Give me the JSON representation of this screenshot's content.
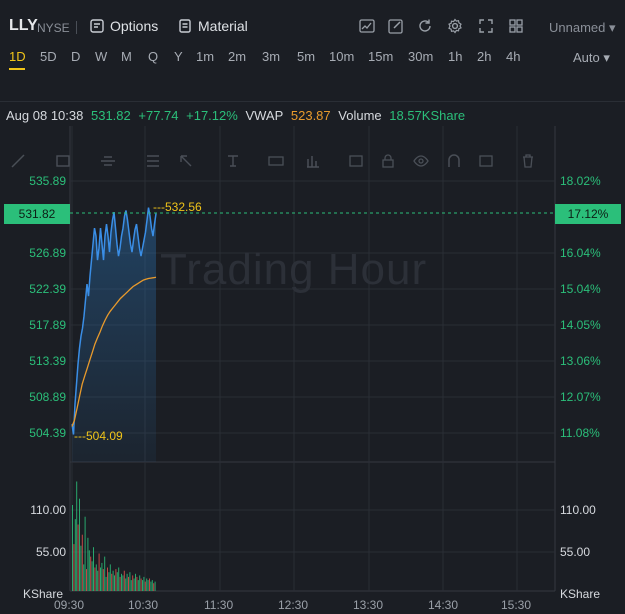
{
  "header": {
    "symbol": "LLY",
    "exchange": "NYSE",
    "options_label": "Options",
    "material_label": "Material",
    "layout_name": "Unnamed"
  },
  "periods": [
    "1D",
    "5D",
    "D",
    "W",
    "M",
    "Q",
    "Y",
    "1m",
    "2m",
    "3m",
    "5m",
    "10m",
    "15m",
    "30m",
    "1h",
    "2h",
    "4h"
  ],
  "active_period": "1D",
  "scale_mode": "Auto",
  "info": {
    "datetime": "Aug 08 10:38",
    "price": "531.82",
    "change": "+77.74",
    "change_pct": "+17.12%",
    "vwap_label": "VWAP",
    "vwap_value": "523.87",
    "volume_label": "Volume",
    "volume_value": "18.57KShare"
  },
  "watermark": "Trading Hour",
  "price_axis_left": [
    "535.89",
    "526.89",
    "522.39",
    "517.89",
    "513.39",
    "508.89",
    "504.39"
  ],
  "price_axis_right": [
    "18.02%",
    "16.04%",
    "15.04%",
    "14.05%",
    "13.06%",
    "12.07%",
    "11.08%"
  ],
  "current_price_badge": "531.82",
  "current_pct_badge": "17.12%",
  "high_label": "532.56",
  "low_label": "504.09",
  "volume_axis": [
    "110.00",
    "55.00"
  ],
  "volume_unit": "KShare",
  "time_axis": [
    "09:30",
    "10:30",
    "11:30",
    "12:30",
    "13:30",
    "14:30",
    "15:30"
  ],
  "colors": {
    "up": "#2bbf7a",
    "down": "#e0504e",
    "price_line": "#3a8ee6",
    "vwap_line": "#e89a2c",
    "highlight": "#f0c419"
  },
  "chart_data": {
    "type": "line",
    "y_axis_range": [
      504.39,
      535.89
    ],
    "series": [
      {
        "name": "",
        "values": [
          505.5,
          504.2,
          508,
          510.5,
          513,
          515,
          516.5,
          517.5,
          519,
          521,
          523,
          521.5,
          524,
          526,
          528,
          530,
          529,
          526,
          527.5,
          530,
          528,
          526,
          529,
          530.5,
          529,
          527,
          529.5,
          531,
          532,
          530,
          528,
          526.5,
          527.5,
          529,
          530,
          531.5,
          532.2,
          531,
          529.5,
          528,
          527,
          528.5,
          529.8,
          530.5,
          529,
          527.5,
          526.5,
          527.5,
          528.5,
          529.5,
          531,
          532.56,
          531.5,
          530,
          529,
          530.5,
          531.82
        ]
      },
      {
        "name": "VWAP",
        "values": [
          505.2,
          506,
          507.5,
          509,
          510.5,
          511.5,
          512.5,
          513.5,
          514.5,
          515.5,
          516.3,
          517,
          517.8,
          518.5,
          519.1,
          519.6,
          520,
          520.4,
          520.8,
          521.2,
          521.5,
          521.8,
          522.1,
          522.4,
          522.7,
          522.9,
          523.1,
          523.3,
          523.5,
          523.6,
          523.7,
          523.75,
          523.8,
          523.87
        ]
      }
    ],
    "volume": [
      110,
      60,
      92,
      140,
      85,
      118,
      58,
      72,
      34,
      95,
      28,
      68,
      52,
      44,
      38,
      56,
      30,
      34,
      26,
      48,
      30,
      36,
      28,
      44,
      18,
      30,
      24,
      34,
      22,
      26,
      20,
      28,
      24,
      30,
      18,
      22,
      20,
      26,
      16,
      22,
      18,
      24,
      14,
      20,
      16,
      22,
      18,
      14,
      20,
      16,
      14,
      18,
      12,
      16,
      14,
      16,
      12,
      14,
      10,
      12
    ],
    "volume_range": [
      0,
      165
    ]
  }
}
